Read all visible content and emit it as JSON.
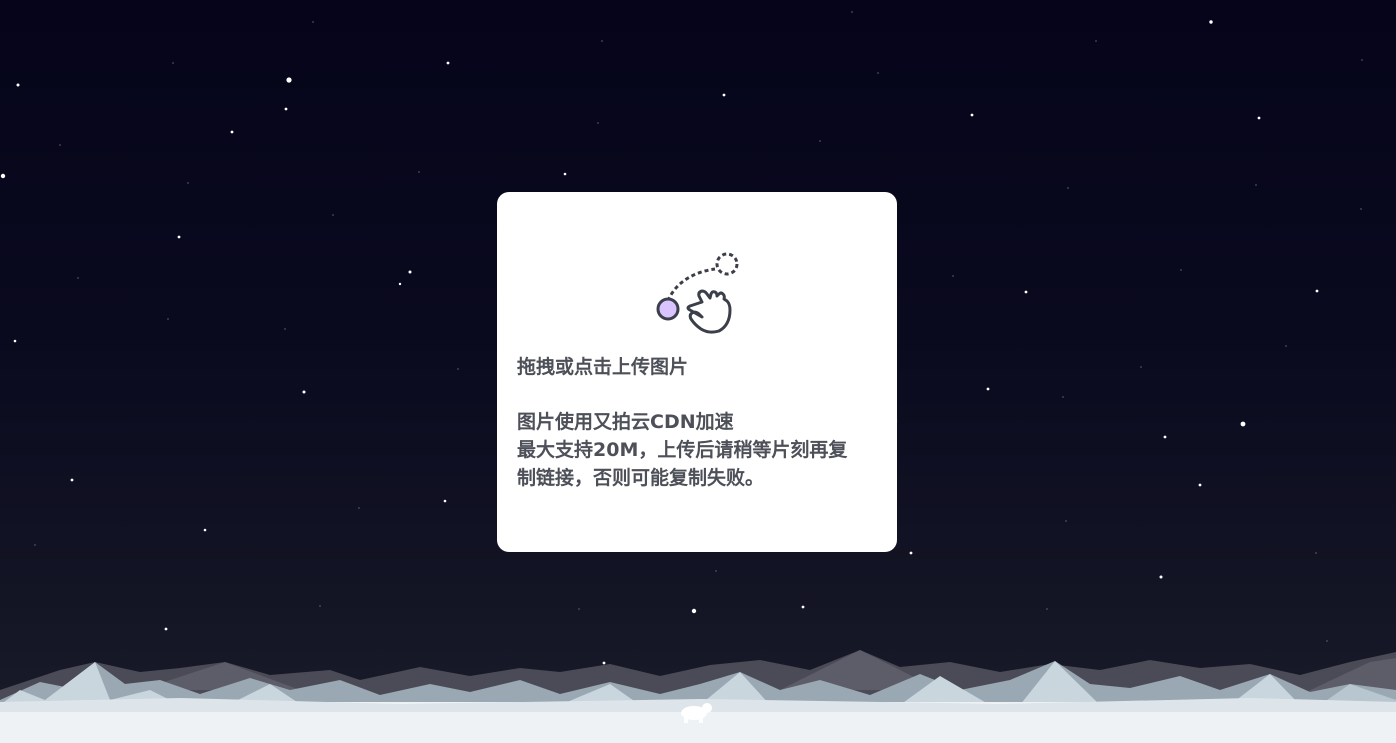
{
  "upload_card": {
    "title": "拖拽或点击上传图片",
    "desc_line1": "图片使用又拍云CDN加速",
    "desc_line2": "最大支持20M，上传后请稍等片刻再复",
    "desc_line3": "制链接，否则可能复制失败。",
    "icon": "drag-hand-icon"
  },
  "colors": {
    "sky_top": "#05041a",
    "sky_bottom": "#1b1d2b",
    "card_bg": "#ffffff",
    "text": "#4d5058",
    "dot_accent": "#d9c4ff",
    "snow": "#f1f4f6"
  }
}
